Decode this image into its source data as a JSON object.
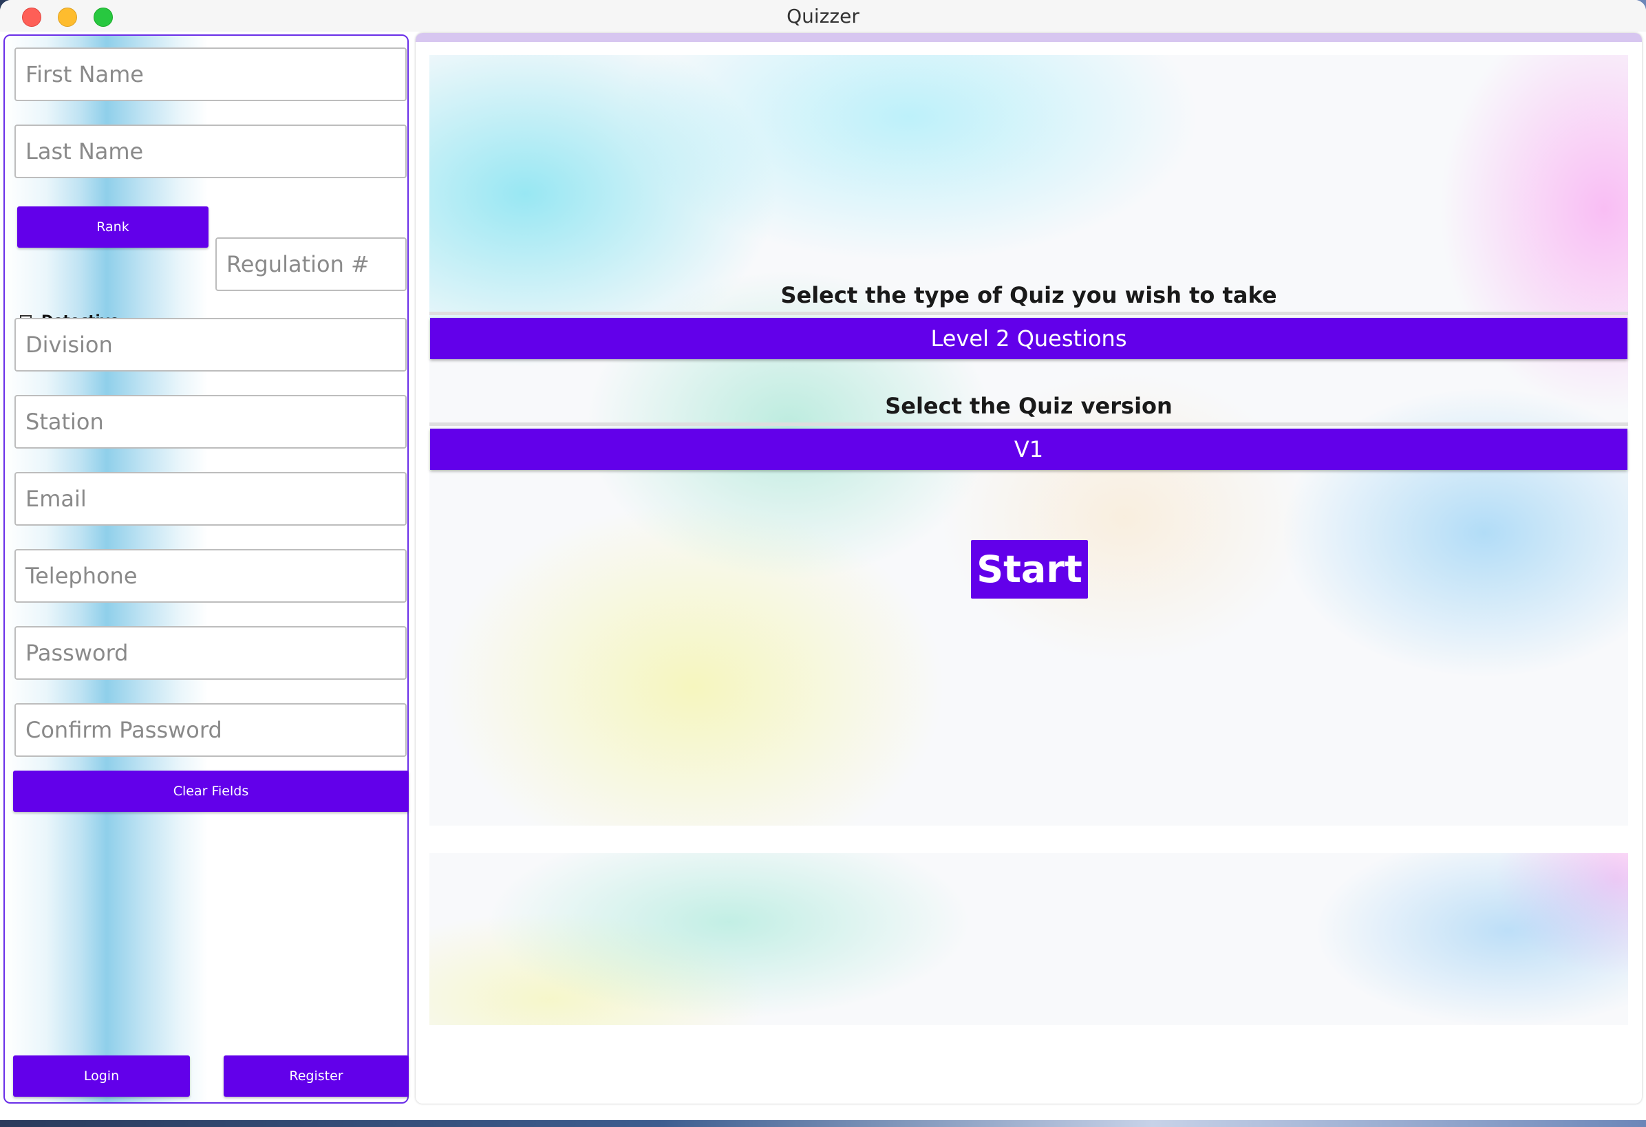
{
  "window": {
    "title": "Quizzer"
  },
  "left": {
    "first_name_placeholder": "First Name",
    "last_name_placeholder": "Last Name",
    "rank_label": "Rank",
    "regulation_placeholder": "Regulation #",
    "detective_label": "Detective",
    "detective_checked": false,
    "division_placeholder": "Division",
    "station_placeholder": "Station",
    "email_placeholder": "Email",
    "telephone_placeholder": "Telephone",
    "password_placeholder": "Password",
    "confirm_password_placeholder": "Confirm Password",
    "clear_fields_label": "Clear Fields",
    "login_label": "Login",
    "register_label": "Register"
  },
  "main": {
    "quiz_type_heading": "Select the type of Quiz you wish to take",
    "quiz_type_selected": "Level 2 Questions",
    "quiz_version_heading": "Select the Quiz version",
    "quiz_version_selected": "V1",
    "start_label": "Start"
  },
  "colors": {
    "accent": "#6200ea",
    "panel_border": "#6a2ee8"
  }
}
